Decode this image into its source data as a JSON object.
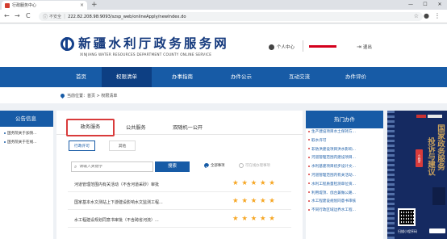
{
  "browser": {
    "tab_title": "行政服务中心",
    "tab_close": "×",
    "new_tab": "+",
    "win_min": "—",
    "win_max": "☐",
    "win_close": "✕",
    "back": "←",
    "forward": "→",
    "reload": "C",
    "info_icon": "ⓘ",
    "insecure_label": "不安全",
    "separator": "|",
    "url": "222.82.208.98:9093/szsp_web/onlineApply/newIndex.do",
    "star": "☆",
    "account_icon": "●",
    "menu_icon": "⋮"
  },
  "header": {
    "title": "新疆水利厅政务服务网",
    "subtitle": "XINJIANG WATER RESOURCES DEPARTMENT  COUNTY  ONLINE  SERVICE",
    "personal_center": "个人中心",
    "logout": "退出"
  },
  "nav": {
    "items": [
      {
        "label": "首页"
      },
      {
        "label": "权限清单"
      },
      {
        "label": "办事指南"
      },
      {
        "label": "办件公示"
      },
      {
        "label": "互动交流"
      },
      {
        "label": "办件评价"
      }
    ],
    "active_index": 1
  },
  "breadcrumb": {
    "text": "当前位置：首页 > 权限清单"
  },
  "notices": {
    "title": "公告信息",
    "items": [
      {
        "text": "国务院关于加快..."
      },
      {
        "text": "国务院关于在线..."
      }
    ]
  },
  "service": {
    "top_tabs": [
      {
        "label": "政务服务"
      },
      {
        "label": "公共服务"
      },
      {
        "label": "双随机一公开"
      }
    ],
    "sub_tabs": [
      {
        "label": "行政许可"
      },
      {
        "label": "其他"
      }
    ],
    "search_placeholder": "请输入关键字",
    "search_button": "搜索",
    "filter_all": "全部事项",
    "filter_online": "可在线办理事项",
    "items": [
      {
        "text": "河道管理范围内有关活动（不含河道采砂）审批",
        "rating": 5
      },
      {
        "text": "国家基本水文测站上下游建设影响水文监测工程...",
        "rating": 5
      },
      {
        "text": "水工程建设规划同意书审批（不含跨省河流）...",
        "rating": 5
      }
    ]
  },
  "hot": {
    "title": "热门办件",
    "items": [
      {
        "text": "生产建设项目水土保持方..."
      },
      {
        "text": "取水许可"
      },
      {
        "text": "非防洪建设项目洪水影响..."
      },
      {
        "text": "河道管理范围内建设项目..."
      },
      {
        "text": "水利基建项目初步设计文..."
      },
      {
        "text": "河道管理范围内有关活动..."
      },
      {
        "text": "水利工程质量检测单位资..."
      },
      {
        "text": "利用堤顶、戗台兼做公路..."
      },
      {
        "text": "水工程建设规划同意书审核"
      },
      {
        "text": "不同行政区域边界水工程..."
      }
    ]
  },
  "banner": {
    "line1": "国家政务服务",
    "line2": "投诉与建议",
    "pill": "小程序",
    "foot": "扫描小程序码"
  },
  "colors": {
    "brand_blue": "#175ba6",
    "nav_active": "#0d3f83",
    "title_blue": "#14397d",
    "accent_red": "#d93b3b",
    "star_orange": "#f6a623"
  }
}
